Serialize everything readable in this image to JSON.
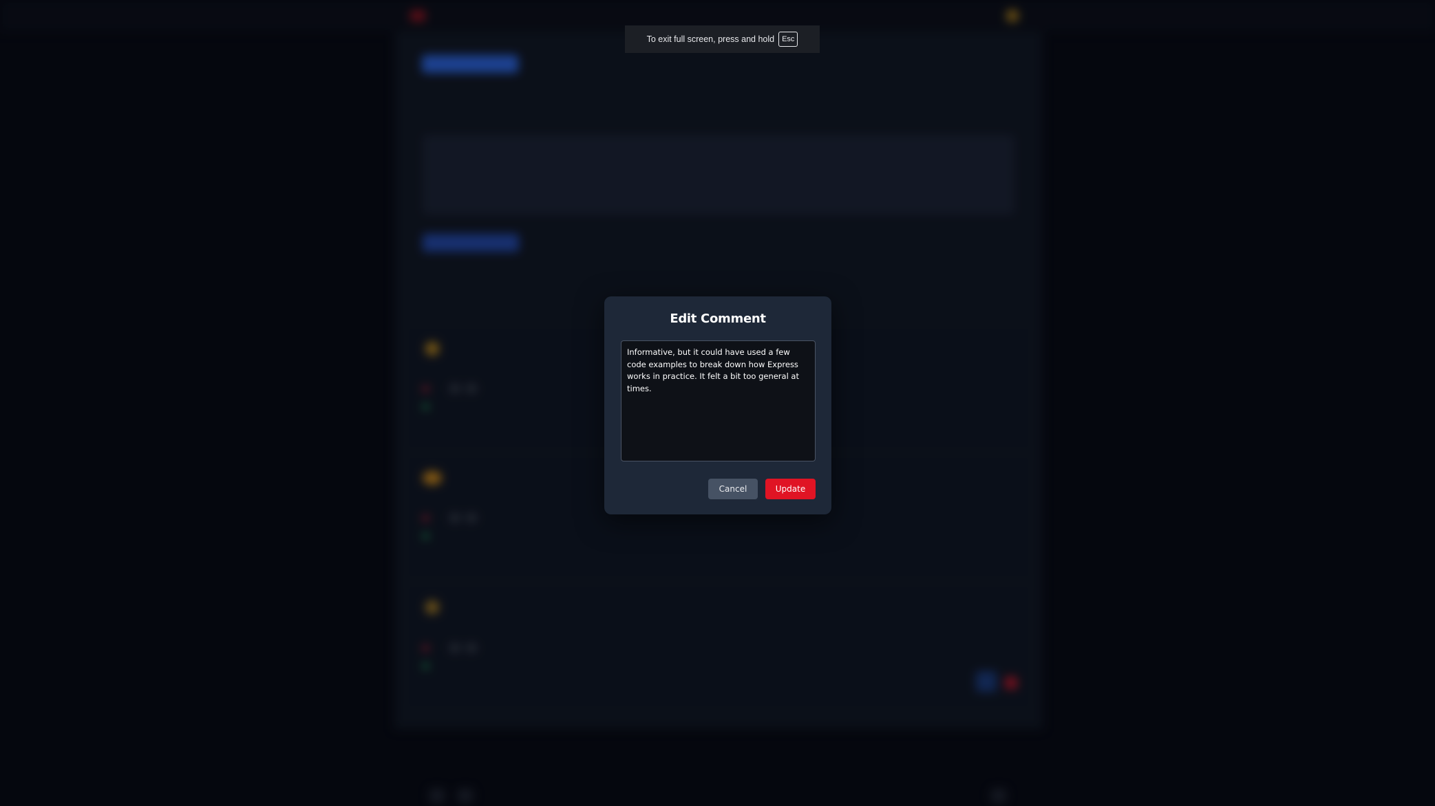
{
  "fullscreen_notice": {
    "text": "To exit full screen, press and hold",
    "key": "Esc"
  },
  "edit_dialog": {
    "title": "Edit Comment",
    "comment_text": "Informative, but it could have used a few code examples to break down how Express works in practice. It felt a bit too general at times.",
    "cancel_label": "Cancel",
    "update_label": "Update"
  },
  "colors": {
    "modal_bg": "#1e2838",
    "update_button": "#e01424",
    "cancel_button": "#465264",
    "page_bg": "#070a12"
  },
  "icons": [
    "logo-icon",
    "avatar-icon",
    "like-icon",
    "reply-icon",
    "edit-icon",
    "delete-icon"
  ]
}
